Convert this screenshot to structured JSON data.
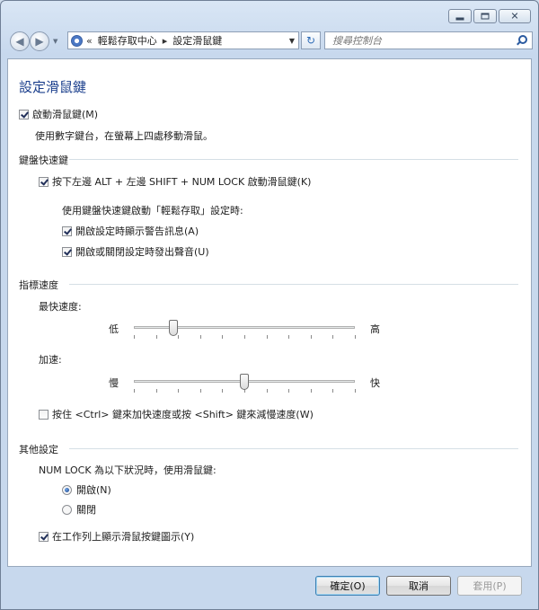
{
  "nav": {
    "address_prefix": "«",
    "breadcrumb_parent": "輕鬆存取中心",
    "breadcrumb_current": "設定滑鼠鍵",
    "search_placeholder": "搜尋控制台"
  },
  "page": {
    "title": "設定滑鼠鍵",
    "enable_label": "啟動滑鼠鍵(M)",
    "enable_desc": "使用數字鍵台，在螢幕上四處移動滑鼠。"
  },
  "keyboard_shortcut": {
    "heading": "鍵盤快速鍵",
    "shortcut_label": "按下左邊 ALT + 左邊 SHIFT + NUM LOCK 啟動滑鼠鍵(K)",
    "when_using_label": "使用鍵盤快速鍵啟動「輕鬆存取」設定時:",
    "warning_label": "開啟設定時顯示警告訊息(A)",
    "sound_label": "開啟或關閉設定時發出聲音(U)"
  },
  "pointer_speed": {
    "heading": "指標速度",
    "top_speed_label": "最快速度:",
    "top_low": "低",
    "top_high": "高",
    "top_speed_value": 0.18,
    "accel_label": "加速:",
    "accel_low": "慢",
    "accel_high": "快",
    "accel_value": 0.5,
    "ctrl_shift_label": "按住 <Ctrl> 鍵來加快速度或按 <Shift> 鍵來減慢速度(W)"
  },
  "other": {
    "heading": "其他設定",
    "numlock_label": "NUM LOCK 為以下狀況時，使用滑鼠鍵:",
    "on_label": "開啟(N)",
    "off_label": "關閉",
    "taskbar_label": "在工作列上顯示滑鼠按鍵圖示(Y)"
  },
  "buttons": {
    "ok": "確定(O)",
    "cancel": "取消",
    "apply": "套用(P)"
  }
}
